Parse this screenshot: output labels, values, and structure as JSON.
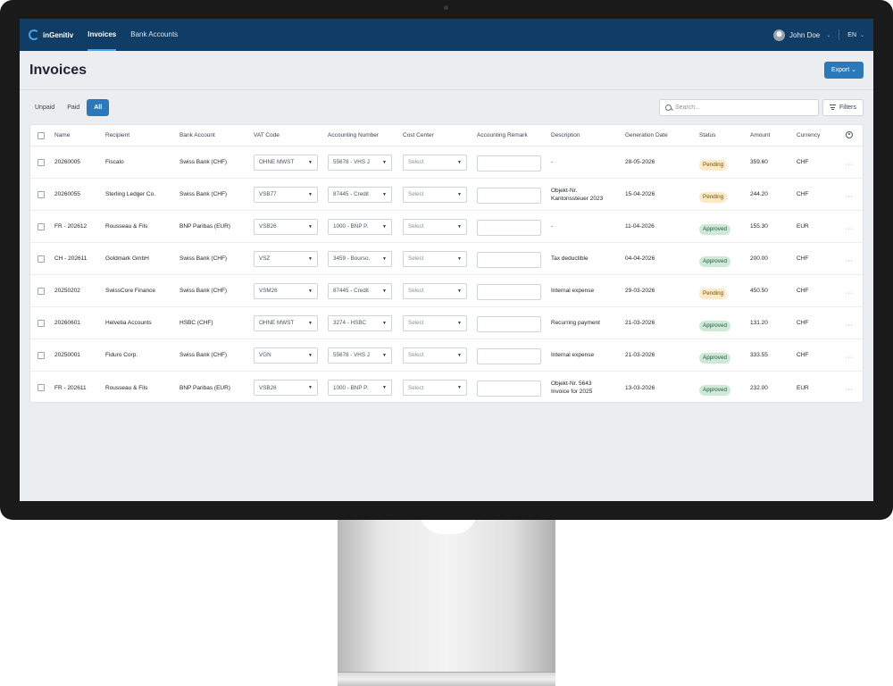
{
  "app": {
    "brand": "inGenitiv",
    "nav": [
      {
        "label": "Invoices",
        "active": true
      },
      {
        "label": "Bank Accounts",
        "active": false
      }
    ],
    "user_name": "John Doe",
    "language": "EN"
  },
  "page": {
    "title": "Invoices",
    "export_label": "Export",
    "tabs": [
      {
        "label": "Unpaid",
        "active": false
      },
      {
        "label": "Paid",
        "active": false
      },
      {
        "label": "All",
        "active": true
      }
    ],
    "search_placeholder": "Search...",
    "filters_label": "Filters"
  },
  "table": {
    "columns": [
      "Name",
      "Recipient",
      "Bank Account",
      "VAT Code",
      "Accounting Number",
      "Cost Center",
      "Accounting Remark",
      "Description",
      "Generation Date",
      "Status",
      "Amount",
      "Currency"
    ],
    "rows": [
      {
        "name": "20260005",
        "recipient": "Fiscalo",
        "bank": "Swiss Bank (CHF)",
        "vat": "OHNE MWST",
        "acc": "55678 - VHS J",
        "cc": "Select",
        "remark": "",
        "desc": "-",
        "date": "28-05-2026",
        "status": "Pending",
        "amount": "359.60",
        "currency": "CHF"
      },
      {
        "name": "20260055",
        "recipient": "Sterling Ledger Co.",
        "bank": "Swiss Bank (CHF)",
        "vat": "VSB77",
        "acc": "87445 - Credit",
        "cc": "Select",
        "remark": "",
        "desc": "Objekt-Nr.\nKantonssteuer 2023",
        "date": "15-04-2026",
        "status": "Pending",
        "amount": "244.20",
        "currency": "CHF"
      },
      {
        "name": "FR - 202612",
        "recipient": "Rousseau & Fils",
        "bank": "BNP Paribas (EUR)",
        "vat": "VSB26",
        "acc": "1000 - BNP P.",
        "cc": "Select",
        "remark": "",
        "desc": "-",
        "date": "11-04-2026",
        "status": "Approved",
        "amount": "155.30",
        "currency": "EUR"
      },
      {
        "name": "CH - 202611",
        "recipient": "Goldmark GmbH",
        "bank": "Swiss Bank (CHF)",
        "vat": "VSZ",
        "acc": "3459 - Bourso.",
        "cc": "Select",
        "remark": "",
        "desc": "Tax deductible",
        "date": "04-04-2026",
        "status": "Approved",
        "amount": "200.00",
        "currency": "CHF"
      },
      {
        "name": "20250202",
        "recipient": "SwissCore Finance",
        "bank": "Swiss Bank (CHF)",
        "vat": "VSM26",
        "acc": "87445 - Credit",
        "cc": "Select",
        "remark": "",
        "desc": "Internal expense",
        "date": "29-03-2026",
        "status": "Pending",
        "amount": "450.50",
        "currency": "CHF"
      },
      {
        "name": "20260601",
        "recipient": "Helvetia Accounts",
        "bank": "HSBC (CHF)",
        "vat": "OHNE MWST",
        "acc": "3274 - HSBC",
        "cc": "Select",
        "remark": "",
        "desc": "Recurring payment",
        "date": "21-03-2026",
        "status": "Approved",
        "amount": "131.20",
        "currency": "CHF"
      },
      {
        "name": "20250001",
        "recipient": "Fiduro Corp.",
        "bank": "Swiss Bank (CHF)",
        "vat": "VGN",
        "acc": "55678 - VHS J",
        "cc": "Select",
        "remark": "",
        "desc": "Internal expense",
        "date": "21-03-2026",
        "status": "Approved",
        "amount": "333.55",
        "currency": "CHF"
      },
      {
        "name": "FR - 202611",
        "recipient": "Rousseau & Fils",
        "bank": "BNP Paribas (EUR)",
        "vat": "VSB26",
        "acc": "1000 - BNP P.",
        "cc": "Select",
        "remark": "",
        "desc": "Objekt-Nr. 5643\nInvoice for 2025",
        "date": "13-03-2026",
        "status": "Approved",
        "amount": "232.00",
        "currency": "EUR"
      }
    ]
  },
  "colors": {
    "topbar": "#0f3d66",
    "accent": "#2b78bb",
    "pending_bg": "#fbeac3",
    "approved_bg": "#cfe9d8"
  }
}
